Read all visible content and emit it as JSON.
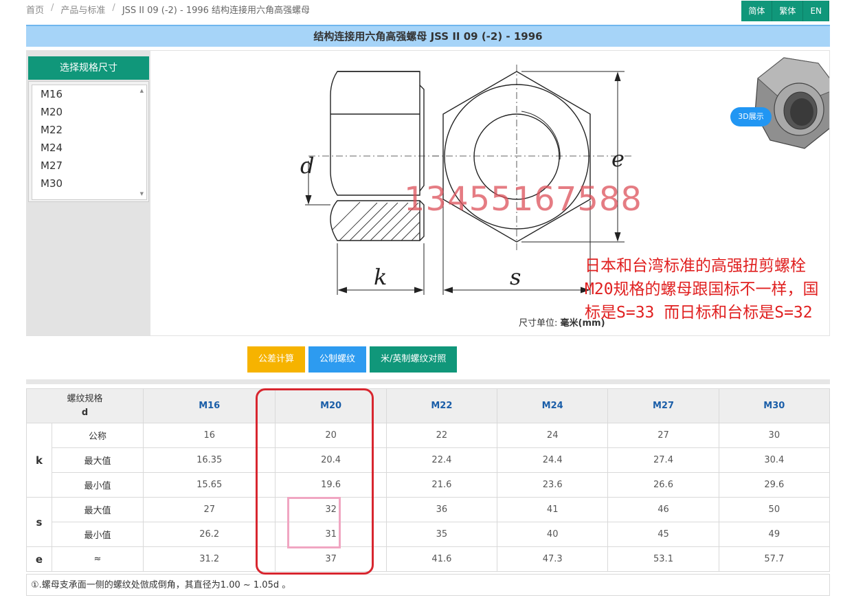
{
  "breadcrumb": {
    "home": "首页",
    "category": "产品与标准",
    "current": "JSS II 09 (-2) - 1996 结构连接用六角高强螺母"
  },
  "languages": [
    "简体",
    "繁体",
    "EN"
  ],
  "title": "结构连接用六角高强螺母 JSS II 09 (-2) - 1996",
  "size_selector": {
    "header": "选择规格尺寸",
    "items": [
      "M16",
      "M20",
      "M22",
      "M24",
      "M27",
      "M30"
    ]
  },
  "drawing": {
    "label_d": "d",
    "label_e": "e",
    "label_k": "k",
    "label_s": "s",
    "unit_prefix": "尺寸单位:",
    "unit_value": "毫米(mm)",
    "btn_3d": "3D展示",
    "phone": "13455167588"
  },
  "annotation": "日本和台湾标准的高强扭剪螺栓M20规格的螺母跟国标不一样，国标是S=33 而日标和台标是S=32",
  "actions": {
    "tolerance": "公差计算",
    "metric_thread": "公制螺纹",
    "conversion": "米/英制螺纹对照"
  },
  "table": {
    "corner_line1": "螺纹规格",
    "corner_line2": "d",
    "columns": [
      "M16",
      "M20",
      "M22",
      "M24",
      "M27",
      "M30"
    ],
    "groups": [
      {
        "name": "k",
        "rows": [
          {
            "label": "公称",
            "values": [
              "16",
              "20",
              "22",
              "24",
              "27",
              "30"
            ]
          },
          {
            "label": "最大值",
            "values": [
              "16.35",
              "20.4",
              "22.4",
              "24.4",
              "27.4",
              "30.4"
            ]
          },
          {
            "label": "最小值",
            "values": [
              "15.65",
              "19.6",
              "21.6",
              "23.6",
              "26.6",
              "29.6"
            ]
          }
        ]
      },
      {
        "name": "s",
        "rows": [
          {
            "label": "最大值",
            "values": [
              "27",
              "32",
              "36",
              "41",
              "46",
              "50"
            ]
          },
          {
            "label": "最小值",
            "values": [
              "26.2",
              "31",
              "35",
              "40",
              "45",
              "49"
            ]
          }
        ]
      },
      {
        "name": "e",
        "rows": [
          {
            "label": "≈",
            "values": [
              "31.2",
              "37",
              "41.6",
              "47.3",
              "53.1",
              "57.7"
            ]
          }
        ]
      }
    ]
  },
  "footnote": "①.螺母支承面一侧的螺纹处倣成倒角，其直径为1.00 ~ 1.05d 。"
}
